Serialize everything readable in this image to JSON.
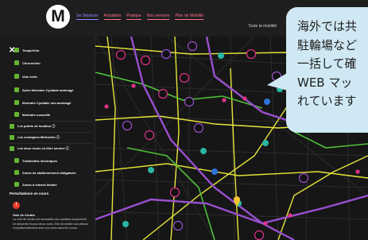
{
  "header": {
    "logo_letter": "M",
    "nav": [
      "Se Déplacer",
      "Actualités",
      "Pratique",
      "Nos services",
      "Plan de Mobilité"
    ],
    "slogan": "Toute la mobilité"
  },
  "sidebar": {
    "close_glyph": "✕",
    "layers": [
      {
        "label": "TempoVélo",
        "sub": true
      },
      {
        "label": "ChronoVélo",
        "sub": true
      },
      {
        "label": "Voie verte",
        "sub": true
      },
      {
        "label": "Autre itinéraire Cyclable aménagé",
        "sub": true
      },
      {
        "label": "Itinéraire Cyclable non aménagé",
        "sub": true
      },
      {
        "label": "Itinéraire conseillé",
        "sub": true
      },
      {
        "label": "Les points de location ⓘ",
        "sub": false
      },
      {
        "label": "Les consignes Métrovélo ⓘ",
        "sub": false
      },
      {
        "label": "Les deux roues en libre service ⓘ",
        "sub": false
      },
      {
        "label": "Trottinettes électriques",
        "sub": true
      },
      {
        "label": "Zones de stationnement obligatoire",
        "sub": true
      },
      {
        "label": "Zones à vitesse limitée",
        "sub": true
      }
    ],
    "disruptions": {
      "heading": "Perturbations en cours",
      "icon": "!",
      "title": "Voie de Corato",
      "text": "La voie de Corato est accessible aux cyclistes uniquement en descente et pour deux roues. Elle est limitée aux piétons exceptionnellement avec vos vélos dans les zones..."
    }
  },
  "bubble": {
    "text": "海外では共\n駐輪場など\n一括して確\nWEB マッ\nれています"
  },
  "colors": {
    "accent_green": "#63b531",
    "route_yellow": "#e6e43a",
    "route_purple": "#9a4fd0",
    "poi_pink": "#e0328a",
    "bubble": "#cfe8f3"
  }
}
